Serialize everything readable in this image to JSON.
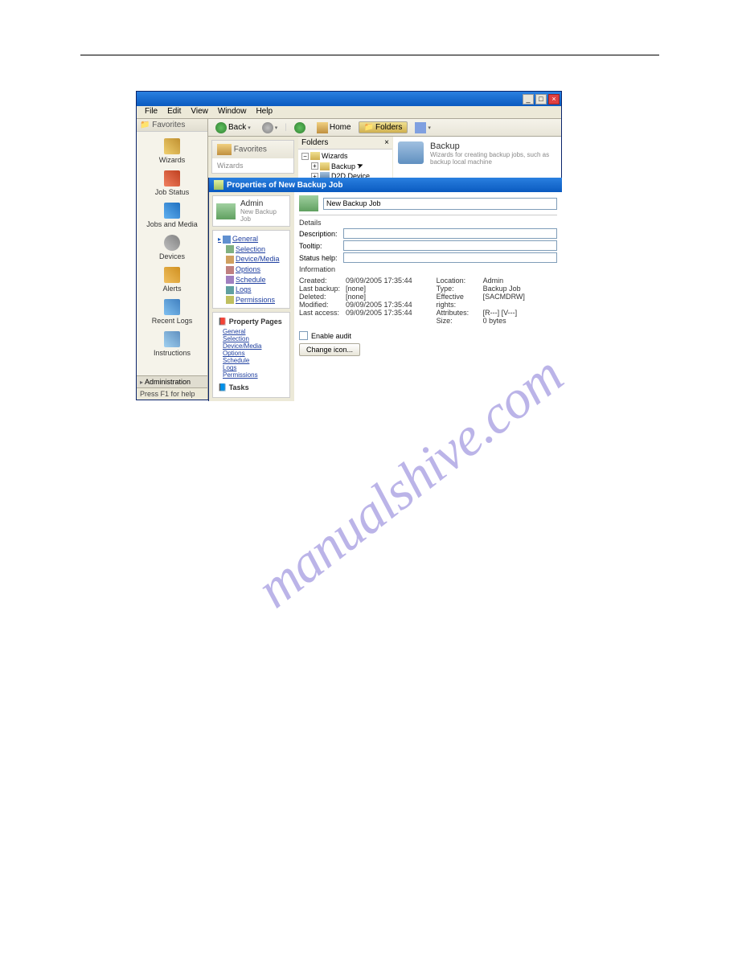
{
  "menubar": [
    "File",
    "Edit",
    "View",
    "Window",
    "Help"
  ],
  "favorites": {
    "header": "Favorites",
    "items": [
      "Wizards",
      "Job Status",
      "Jobs and Media",
      "Devices",
      "Alerts",
      "Recent Logs",
      "Instructions"
    ],
    "admin": "Administration",
    "status": "Press F1 for help"
  },
  "toolbar": {
    "back": "Back",
    "home": "Home",
    "folders": "Folders"
  },
  "fav_panel": {
    "title": "Favorites",
    "sub": "Wizards"
  },
  "folders_panel": {
    "title": "Folders",
    "root": "Wizards",
    "items": [
      "Backup",
      "D2D Device"
    ]
  },
  "backup_card": {
    "title": "Backup",
    "desc": "Wizards for creating backup jobs, such as backup local machine"
  },
  "dialog": {
    "title": "Properties of New Backup Job",
    "admin": {
      "t1": "Admin",
      "t2": "New Backup Job"
    },
    "nav": [
      "General",
      "Selection",
      "Device/Media",
      "Options",
      "Schedule",
      "Logs",
      "Permissions"
    ],
    "prop_pages_hd": "Property Pages",
    "prop_pages": [
      "General",
      "Selection",
      "Device/Media",
      "Options",
      "Schedule",
      "Logs",
      "Permissions"
    ],
    "tasks_hd": "Tasks",
    "form_title": "New Backup Job",
    "details_hd": "Details",
    "labels": {
      "description": "Description:",
      "tooltip": "Tooltip:",
      "statushelp": "Status help:"
    },
    "info_hd": "Information",
    "info_left": {
      "Created:": "09/09/2005 17:35:44",
      "Last backup:": "[none]",
      "Deleted:": "[none]",
      "Modified:": "09/09/2005 17:35:44",
      "Last access:": "09/09/2005 17:35:44"
    },
    "info_right": {
      "Location:": "Admin",
      "Type:": "Backup Job",
      "Effective rights:": "[SACMDRW]",
      "Attributes:": "[R---] [V---]",
      "Size:": "0 bytes"
    },
    "enable_audit": "Enable audit",
    "change_icon": "Change icon..."
  },
  "watermark": "manualshive.com"
}
